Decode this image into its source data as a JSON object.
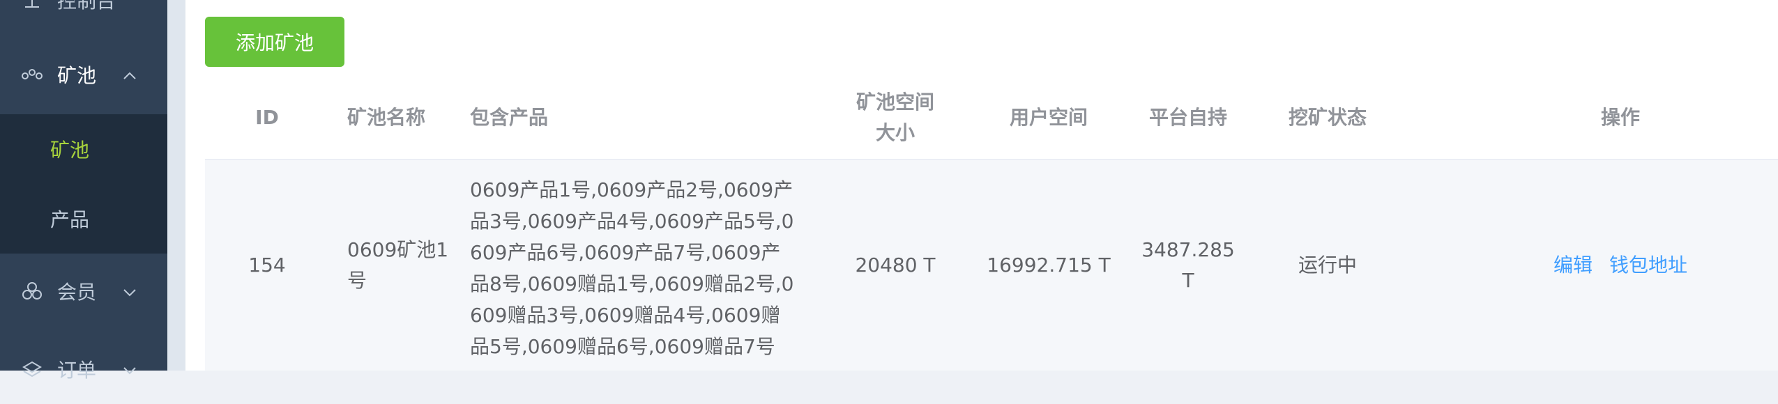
{
  "sidebar": {
    "items": [
      {
        "label": "控制台"
      },
      {
        "label": "矿池"
      },
      {
        "label": "会员"
      },
      {
        "label": "订单"
      }
    ],
    "submenu": [
      {
        "label": "矿池",
        "active": true
      },
      {
        "label": "产品",
        "active": false
      }
    ]
  },
  "toolbar": {
    "add_label": "添加矿池"
  },
  "table": {
    "headers": {
      "id": "ID",
      "name": "矿池名称",
      "products": "包含产品",
      "space_line1": "矿池空间",
      "space_line2": "大小",
      "user_space": "用户空间",
      "platform": "平台自持",
      "status": "挖矿状态",
      "actions": "操作"
    },
    "rows": [
      {
        "id": "154",
        "name": "0609矿池1号",
        "products": "0609产品1号,0609产品2号,0609产品3号,0609产品4号,0609产品5号,0609产品6号,0609产品7号,0609产品8号,0609赠品1号,0609赠品2号,0609赠品3号,0609赠品4号,0609赠品5号,0609赠品6号,0609赠品7号",
        "space": "20480 T",
        "user_space": "16992.715 T",
        "platform": "3487.285 T",
        "status": "运行中",
        "edit": "编辑",
        "wallet": "钱包地址"
      }
    ]
  },
  "colors": {
    "sidebar_bg": "#304156",
    "submenu_bg": "#1f2d3d",
    "active_text": "#a7d33c",
    "add_button": "#67c23a",
    "link": "#409eff"
  }
}
